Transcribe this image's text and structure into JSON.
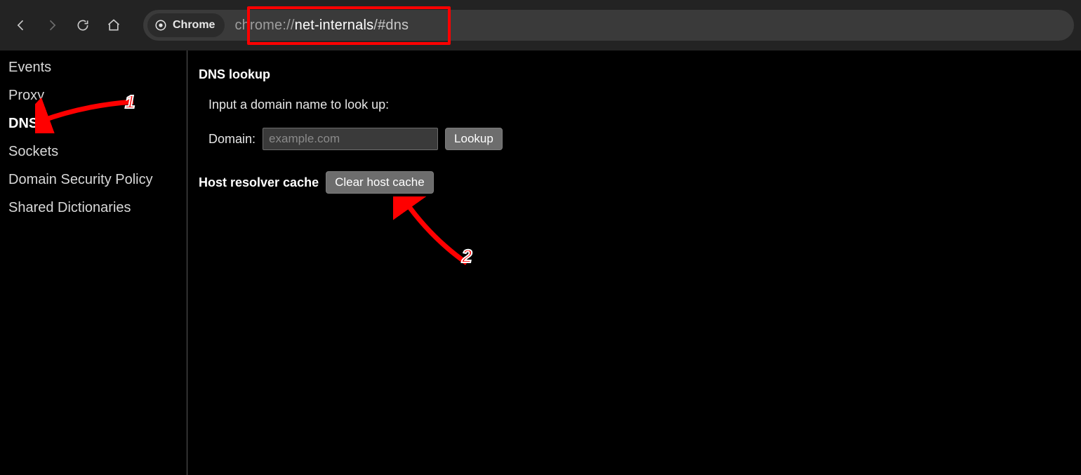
{
  "browser": {
    "origin_chip_label": "Chrome",
    "url": {
      "scheme": "chrome://",
      "host": "net-internals",
      "path": "/#dns"
    }
  },
  "sidebar": {
    "items": [
      {
        "label": "Events"
      },
      {
        "label": "Proxy"
      },
      {
        "label": "DNS",
        "active": true
      },
      {
        "label": "Sockets"
      },
      {
        "label": "Domain Security Policy"
      },
      {
        "label": "Shared Dictionaries"
      }
    ]
  },
  "main": {
    "dns_lookup_heading": "DNS lookup",
    "helper_text": "Input a domain name to look up:",
    "domain_label": "Domain:",
    "domain_placeholder": "example.com",
    "lookup_button": "Lookup",
    "host_resolver_heading": "Host resolver cache",
    "clear_cache_button": "Clear host cache"
  },
  "annotations": {
    "num1": "1",
    "num2": "2"
  }
}
